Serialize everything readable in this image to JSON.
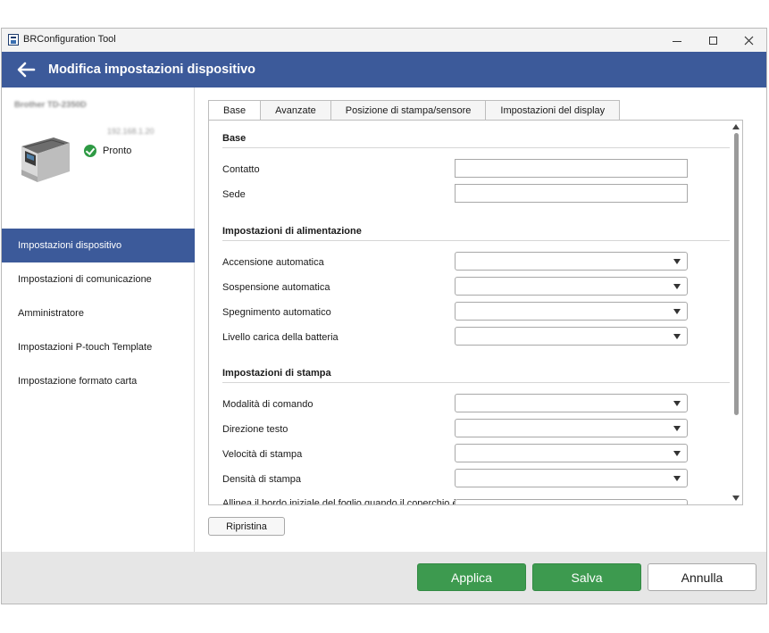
{
  "window": {
    "title": "BRConfiguration Tool"
  },
  "header": {
    "title": "Modifica impostazioni dispositivo"
  },
  "device": {
    "name": "Brother TD-2350D",
    "ip": "192.168.1.20",
    "status": "Pronto"
  },
  "sidebar": {
    "items": [
      {
        "label": "Impostazioni dispositivo",
        "active": true
      },
      {
        "label": "Impostazioni di comunicazione",
        "active": false
      },
      {
        "label": "Amministratore",
        "active": false
      },
      {
        "label": "Impostazioni P-touch Template",
        "active": false
      },
      {
        "label": "Impostazione formato carta",
        "active": false
      }
    ]
  },
  "tabs": [
    {
      "label": "Base",
      "active": true
    },
    {
      "label": "Avanzate",
      "active": false
    },
    {
      "label": "Posizione di stampa/sensore",
      "active": false
    },
    {
      "label": "Impostazioni del display",
      "active": false
    }
  ],
  "sections": {
    "base": {
      "title": "Base",
      "contatto": {
        "label": "Contatto",
        "value": ""
      },
      "sede": {
        "label": "Sede",
        "value": ""
      }
    },
    "power": {
      "title": "Impostazioni di alimentazione",
      "rows": [
        {
          "label": "Accensione automatica",
          "value": ""
        },
        {
          "label": "Sospensione automatica",
          "value": ""
        },
        {
          "label": "Spegnimento automatico",
          "value": ""
        },
        {
          "label": "Livello carica della batteria",
          "value": ""
        }
      ]
    },
    "print": {
      "title": "Impostazioni di stampa",
      "rows": [
        {
          "label": "Modalità di comando",
          "value": ""
        },
        {
          "label": "Direzione testo",
          "value": ""
        },
        {
          "label": "Velocità di stampa",
          "value": ""
        },
        {
          "label": "Densità di stampa",
          "value": ""
        },
        {
          "label": "Allinea il bordo iniziale del foglio quando il coperchio è",
          "value": ""
        }
      ]
    }
  },
  "buttons": {
    "reset": "Ripristina",
    "apply": "Applica",
    "save": "Salva",
    "cancel": "Annulla"
  },
  "colors": {
    "header": "#3c5a9a",
    "active_nav": "#3c5a9a",
    "primary_button": "#3d9a4f",
    "status_ok": "#2e9a44"
  }
}
